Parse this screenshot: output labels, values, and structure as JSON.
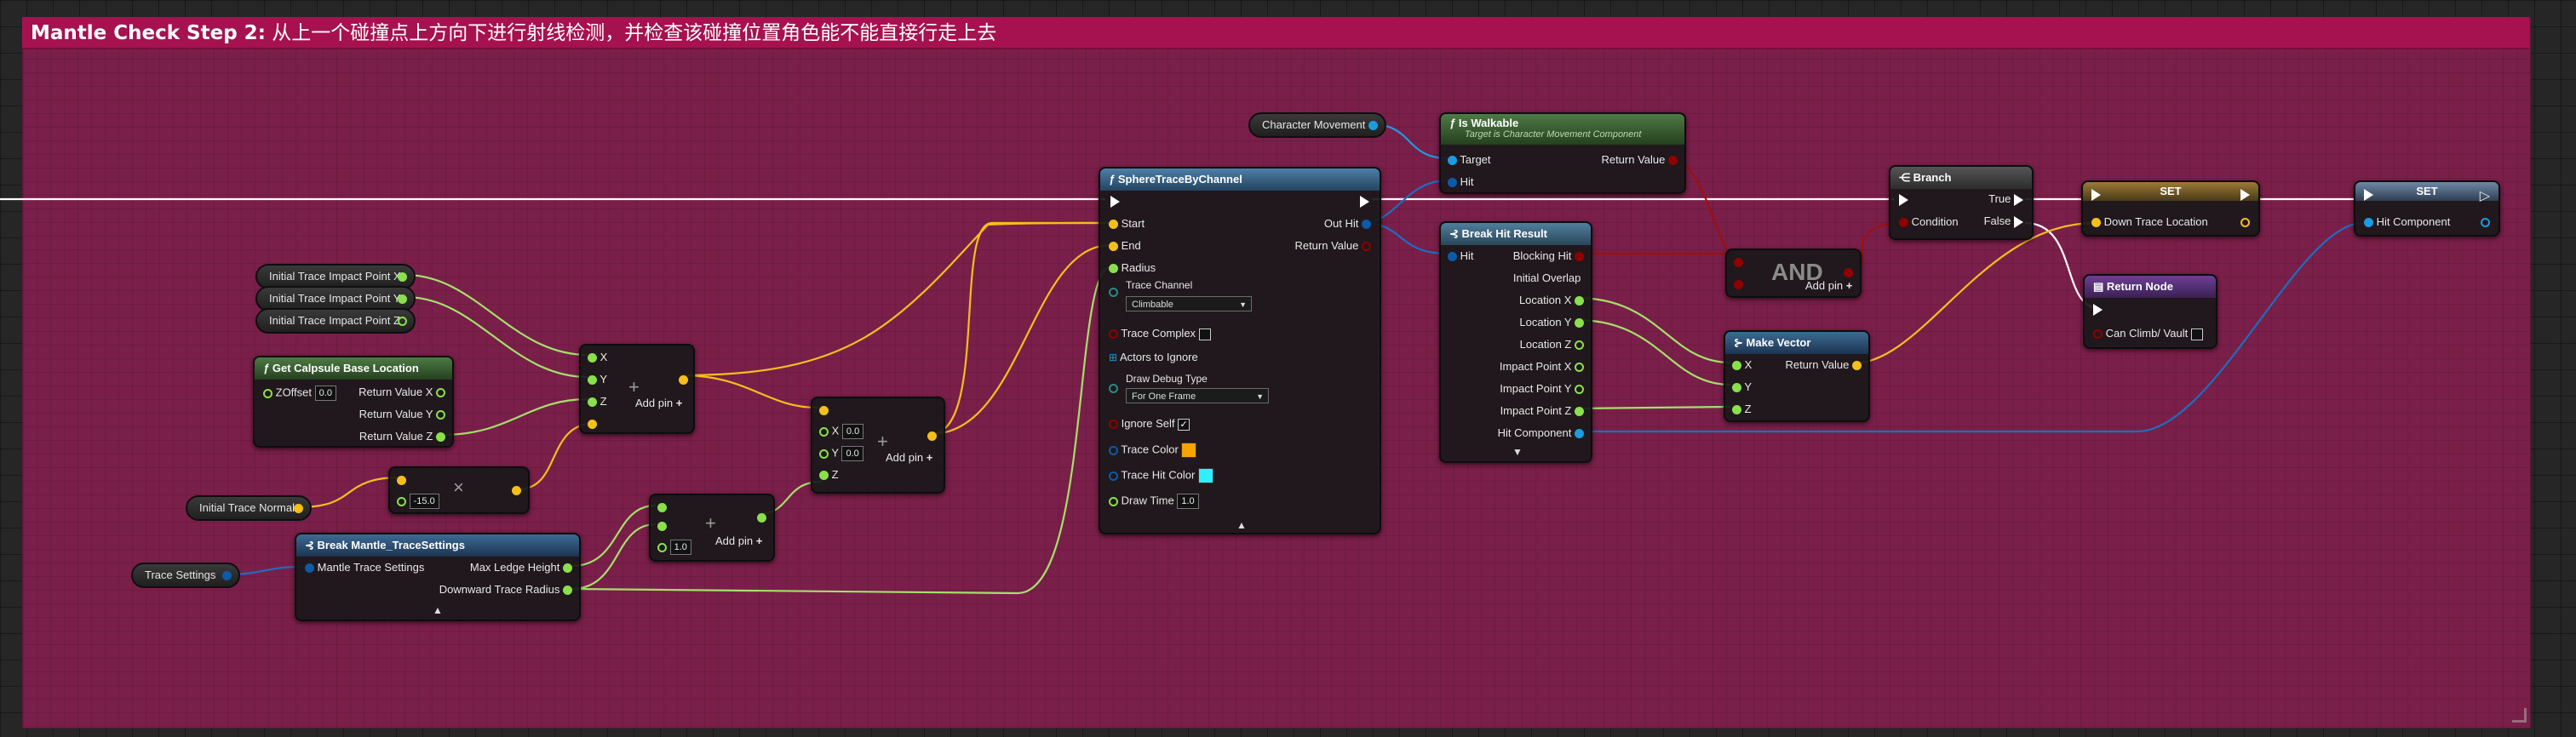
{
  "comment": {
    "title_bold": "Mantle Check Step 2:",
    "title_rest": " 从上一个碰撞点上方向下进行射线检测，并检查该碰撞位置角色能不能直接行走上去"
  },
  "colors": {
    "comment_bg": "#7a1f4a",
    "comment_header": "#a5124f",
    "vector_pin": "#f3c01b",
    "float_pin": "#8ae04b",
    "bool_pin": "#8f0000",
    "object_pin": "#1a9ce0",
    "struct_pin": "#0d5aa8",
    "trace_color": "#f5a300",
    "trace_hit_color": "#2ff0ff"
  },
  "variables": {
    "impact_x": "Initial Trace Impact Point X",
    "impact_y": "Initial Trace Impact Point Y",
    "impact_z": "Initial Trace Impact Point Z",
    "trace_normal": "Initial Trace Normal",
    "trace_settings": "Trace Settings",
    "character_movement": "Character Movement"
  },
  "capsule": {
    "title": "Get Calpsule Base Location",
    "zoffset_label": "ZOffset",
    "zoffset_value": "0.0",
    "rx": "Return Value X",
    "ry": "Return Value Y",
    "rz": "Return Value Z"
  },
  "make_vec1": {
    "x": "X",
    "y": "Y",
    "z": "Z",
    "add": "Add pin"
  },
  "make_vec2": {
    "x": "X",
    "xv": "0.0",
    "y": "Y",
    "yv": "0.0",
    "z": "Z",
    "add": "Add pin"
  },
  "mult_node": {
    "value": "-15.0"
  },
  "add_float": {
    "value": "1.0",
    "add": "Add pin"
  },
  "break_mantle": {
    "title": "Break Mantle_TraceSettings",
    "in": "Mantle Trace Settings",
    "out1": "Max Ledge Height",
    "out2": "Downward Trace Radius"
  },
  "sphere_trace": {
    "title": "SphereTraceByChannel",
    "start": "Start",
    "end": "End",
    "radius": "Radius",
    "trace_channel": "Trace Channel",
    "trace_channel_value": "Climbable",
    "trace_complex": "Trace Complex",
    "actors_ignore": "Actors to Ignore",
    "draw_debug": "Draw Debug Type",
    "draw_debug_value": "For One Frame",
    "ignore_self": "Ignore Self",
    "trace_color": "Trace Color",
    "trace_hit_color": "Trace Hit Color",
    "draw_time": "Draw Time",
    "draw_time_value": "1.0",
    "out_hit": "Out Hit",
    "return_value": "Return Value"
  },
  "is_walkable": {
    "title": "Is Walkable",
    "subtitle": "Target is Character Movement Component",
    "target": "Target",
    "hit": "Hit",
    "return_value": "Return Value"
  },
  "break_hit": {
    "title": "Break Hit Result",
    "hit": "Hit",
    "outputs": [
      "Blocking Hit",
      "Initial Overlap",
      "Location X",
      "Location Y",
      "Location Z",
      "Impact Point X",
      "Impact Point Y",
      "Impact Point Z",
      "Hit Component"
    ]
  },
  "and_node": {
    "label": "AND",
    "add": "Add pin"
  },
  "make_vector": {
    "title": "Make Vector",
    "x": "X",
    "y": "Y",
    "z": "Z",
    "return_value": "Return Value"
  },
  "branch": {
    "title": "Branch",
    "condition": "Condition",
    "true": "True",
    "false": "False"
  },
  "set1": {
    "title": "SET",
    "pin": "Down Trace Location"
  },
  "set2": {
    "title": "SET",
    "pin": "Hit Component"
  },
  "return_node": {
    "title": "Return Node",
    "pin": "Can Climb/ Vault"
  }
}
